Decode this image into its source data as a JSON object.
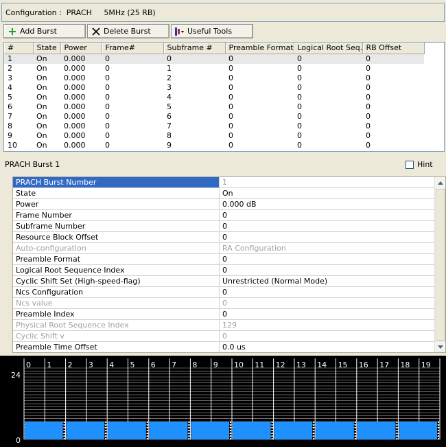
{
  "config": {
    "text": "Configuration :  PRACH     5MHz (25 RB)"
  },
  "toolbar": {
    "add": "Add Burst",
    "delete": "Delete Burst",
    "tools": "Useful Tools"
  },
  "table": {
    "headers": [
      "#",
      "State",
      "Power",
      "Frame#",
      "Subframe #",
      "Preamble Format",
      "Logical Root Seq.",
      "RB Offset"
    ],
    "rows": [
      [
        "1",
        "On",
        "0.000",
        "0",
        "0",
        "0",
        "0",
        "0"
      ],
      [
        "2",
        "On",
        "0.000",
        "0",
        "1",
        "0",
        "0",
        "0"
      ],
      [
        "3",
        "On",
        "0.000",
        "0",
        "2",
        "0",
        "0",
        "0"
      ],
      [
        "4",
        "On",
        "0.000",
        "0",
        "3",
        "0",
        "0",
        "0"
      ],
      [
        "5",
        "On",
        "0.000",
        "0",
        "4",
        "0",
        "0",
        "0"
      ],
      [
        "6",
        "On",
        "0.000",
        "0",
        "5",
        "0",
        "0",
        "0"
      ],
      [
        "7",
        "On",
        "0.000",
        "0",
        "6",
        "0",
        "0",
        "0"
      ],
      [
        "8",
        "On",
        "0.000",
        "0",
        "7",
        "0",
        "0",
        "0"
      ],
      [
        "9",
        "On",
        "0.000",
        "0",
        "8",
        "0",
        "0",
        "0"
      ],
      [
        "10",
        "On",
        "0.000",
        "0",
        "9",
        "0",
        "0",
        "0"
      ]
    ]
  },
  "section_title": "PRACH Burst 1",
  "hint_label": "Hint",
  "properties": [
    {
      "name": "PRACH Burst Number",
      "value": "1",
      "state": "selected"
    },
    {
      "name": "State",
      "value": "On",
      "state": "normal"
    },
    {
      "name": "Power",
      "value": "0.000 dB",
      "state": "normal"
    },
    {
      "name": "Frame Number",
      "value": "0",
      "state": "normal"
    },
    {
      "name": "Subframe Number",
      "value": "0",
      "state": "normal"
    },
    {
      "name": "Resource Block Offset",
      "value": "0",
      "state": "normal"
    },
    {
      "name": "Auto-configuration",
      "value": "RA Configuration",
      "state": "disabled"
    },
    {
      "name": "Preamble Format",
      "value": "0",
      "state": "normal"
    },
    {
      "name": "Logical Root Sequence Index",
      "value": "0",
      "state": "normal"
    },
    {
      "name": "Cyclic Shift Set (High-speed-flag)",
      "value": "Unrestricted (Normal Mode)",
      "state": "normal"
    },
    {
      "name": "Ncs Configuration",
      "value": "0",
      "state": "normal"
    },
    {
      "name": "Ncs value",
      "value": "0",
      "state": "disabled"
    },
    {
      "name": "Preamble Index",
      "value": "0",
      "state": "normal"
    },
    {
      "name": "Physical Root Sequence Index",
      "value": "129",
      "state": "disabled"
    },
    {
      "name": "Cyclic Shift v",
      "value": "0",
      "state": "disabled"
    },
    {
      "name": "Preamble Time Offset",
      "value": "0.0 us",
      "state": "normal"
    }
  ],
  "chart_data": {
    "type": "bar",
    "x_ticks": [
      "0",
      "1",
      "2",
      "3",
      "4",
      "5",
      "6",
      "7",
      "8",
      "9",
      "10",
      "11",
      "12",
      "13",
      "14",
      "15",
      "16",
      "17",
      "18",
      "19"
    ],
    "y_ticks": [
      "24",
      "0"
    ],
    "ylim": [
      0,
      24
    ],
    "block_pairs": 10,
    "bar_color": "#1e90ff",
    "background": "#000000"
  }
}
